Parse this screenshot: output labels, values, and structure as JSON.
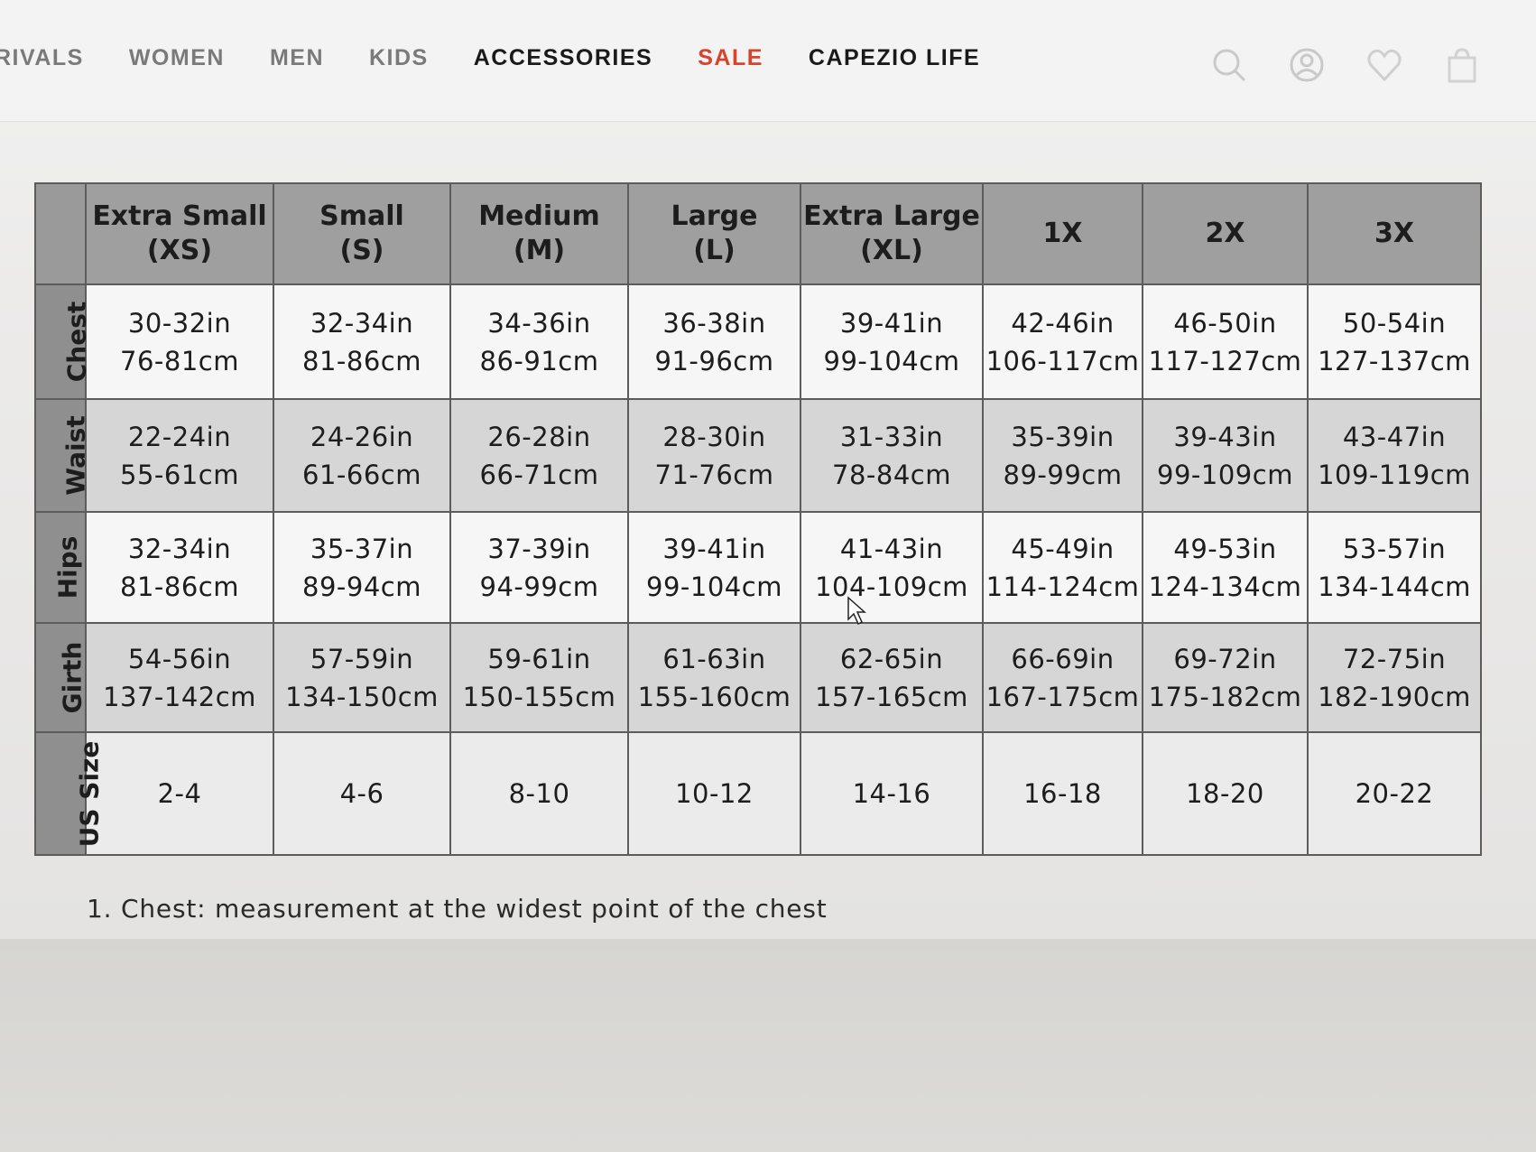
{
  "nav": {
    "items": [
      {
        "label": "RIVALS",
        "style": "muted"
      },
      {
        "label": "WOMEN",
        "style": "muted"
      },
      {
        "label": "MEN",
        "style": "muted"
      },
      {
        "label": "KIDS",
        "style": "muted"
      },
      {
        "label": "ACCESSORIES",
        "style": "dark"
      },
      {
        "label": "SALE",
        "style": "sale"
      },
      {
        "label": "CAPEZIO LIFE",
        "style": "dark"
      }
    ],
    "icons": [
      "search-icon",
      "account-icon",
      "heart-icon",
      "bag-icon"
    ],
    "sale_color": "#d9422b"
  },
  "size_chart": {
    "columns": [
      {
        "line1": "Extra Small",
        "line2": "(XS)"
      },
      {
        "line1": "Small",
        "line2": "(S)"
      },
      {
        "line1": "Medium",
        "line2": "(M)"
      },
      {
        "line1": "Large",
        "line2": "(L)"
      },
      {
        "line1": "Extra Large",
        "line2": "(XL)"
      },
      {
        "line1": "1X",
        "line2": ""
      },
      {
        "line1": "2X",
        "line2": ""
      },
      {
        "line1": "3X",
        "line2": ""
      }
    ],
    "rows": [
      {
        "label": "Chest",
        "cells": [
          [
            "30-32in",
            "76-81cm"
          ],
          [
            "32-34in",
            "81-86cm"
          ],
          [
            "34-36in",
            "86-91cm"
          ],
          [
            "36-38in",
            "91-96cm"
          ],
          [
            "39-41in",
            "99-104cm"
          ],
          [
            "42-46in",
            "106-117cm"
          ],
          [
            "46-50in",
            "117-127cm"
          ],
          [
            "50-54in",
            "127-137cm"
          ]
        ]
      },
      {
        "label": "Waist",
        "cells": [
          [
            "22-24in",
            "55-61cm"
          ],
          [
            "24-26in",
            "61-66cm"
          ],
          [
            "26-28in",
            "66-71cm"
          ],
          [
            "28-30in",
            "71-76cm"
          ],
          [
            "31-33in",
            "78-84cm"
          ],
          [
            "35-39in",
            "89-99cm"
          ],
          [
            "39-43in",
            "99-109cm"
          ],
          [
            "43-47in",
            "109-119cm"
          ]
        ]
      },
      {
        "label": "Hips",
        "cells": [
          [
            "32-34in",
            "81-86cm"
          ],
          [
            "35-37in",
            "89-94cm"
          ],
          [
            "37-39in",
            "94-99cm"
          ],
          [
            "39-41in",
            "99-104cm"
          ],
          [
            "41-43in",
            "104-109cm"
          ],
          [
            "45-49in",
            "114-124cm"
          ],
          [
            "49-53in",
            "124-134cm"
          ],
          [
            "53-57in",
            "134-144cm"
          ]
        ]
      },
      {
        "label": "Girth",
        "cells": [
          [
            "54-56in",
            "137-142cm"
          ],
          [
            "57-59in",
            "134-150cm"
          ],
          [
            "59-61in",
            "150-155cm"
          ],
          [
            "61-63in",
            "155-160cm"
          ],
          [
            "62-65in",
            "157-165cm"
          ],
          [
            "66-69in",
            "167-175cm"
          ],
          [
            "69-72in",
            "175-182cm"
          ],
          [
            "72-75in",
            "182-190cm"
          ]
        ]
      },
      {
        "label": "US Size",
        "cells": [
          [
            "2-4",
            ""
          ],
          [
            "4-6",
            ""
          ],
          [
            "8-10",
            ""
          ],
          [
            "10-12",
            ""
          ],
          [
            "14-16",
            ""
          ],
          [
            "16-18",
            ""
          ],
          [
            "18-20",
            ""
          ],
          [
            "20-22",
            ""
          ]
        ]
      }
    ]
  },
  "footnote": "1. Chest: measurement at the widest point of the chest"
}
